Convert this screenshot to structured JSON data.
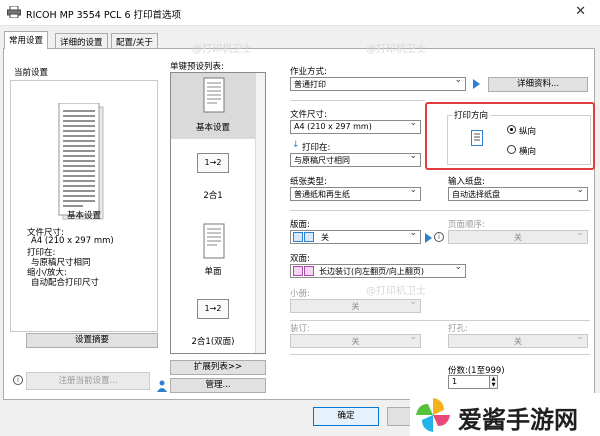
{
  "window": {
    "title": "RICOH MP 3554 PCL 6 打印首选项",
    "close": "✕"
  },
  "tabs": [
    {
      "label": "常用设置"
    },
    {
      "label": "详细的设置"
    },
    {
      "label": "配置/关于"
    }
  ],
  "preview": {
    "header": "当前设置",
    "caption": "基本设置",
    "summary": [
      "文件尺寸:",
      "A4 (210 x 297 mm)",
      "打印在:",
      "与原稿尺寸相同",
      "缩小/放大:",
      "自动配合打印尺寸"
    ],
    "summary_button": "设置摘要",
    "register_button": "注册当前设置..."
  },
  "presets": {
    "header": "单键预设列表:",
    "items": [
      {
        "label": "基本设置",
        "glyph": ""
      },
      {
        "label": "2合1",
        "glyph": "1→2"
      },
      {
        "label": "单面",
        "glyph": ""
      },
      {
        "label": "2合1(双面)",
        "glyph": "1→2"
      }
    ],
    "expand_button": "扩展列表>>",
    "manage_button": "管理..."
  },
  "job": {
    "label": "作业方式:",
    "value": "普通打印",
    "details_button": "详细资料..."
  },
  "paper_size": {
    "label": "文件尺寸:",
    "value": "A4 (210 x 297 mm)"
  },
  "print_on": {
    "label": "打印在:",
    "value": "与原稿尺寸相同"
  },
  "orientation": {
    "label": "打印方向",
    "options": [
      "纵向",
      "横向"
    ],
    "selected": 0
  },
  "paper_type": {
    "label": "纸张类型:",
    "value": "普通纸和再生纸"
  },
  "input_tray": {
    "label": "输入纸盘:",
    "value": "自动选择纸盘"
  },
  "layout": {
    "label": "版面:",
    "value": "关"
  },
  "page_order": {
    "label": "页面顺序:",
    "value": "关"
  },
  "duplex": {
    "label": "双面:",
    "value": "长边装订(向左翻页/向上翻页)"
  },
  "booklet": {
    "label": "小册:",
    "value": "关"
  },
  "staple": {
    "label": "装订:",
    "value": "关"
  },
  "punch": {
    "label": "打孔:",
    "value": "关"
  },
  "copies": {
    "label": "份数:(1至999)",
    "value": "1"
  },
  "footer": {
    "ok": "确定"
  },
  "watermark": {
    "text": "@打印机卫士"
  },
  "brand": {
    "text": "爱酱手游网"
  },
  "colors": {
    "accent": "#0078d7",
    "highlight_red": "#e23d3d",
    "arrow_blue": "#2f7fd1"
  }
}
